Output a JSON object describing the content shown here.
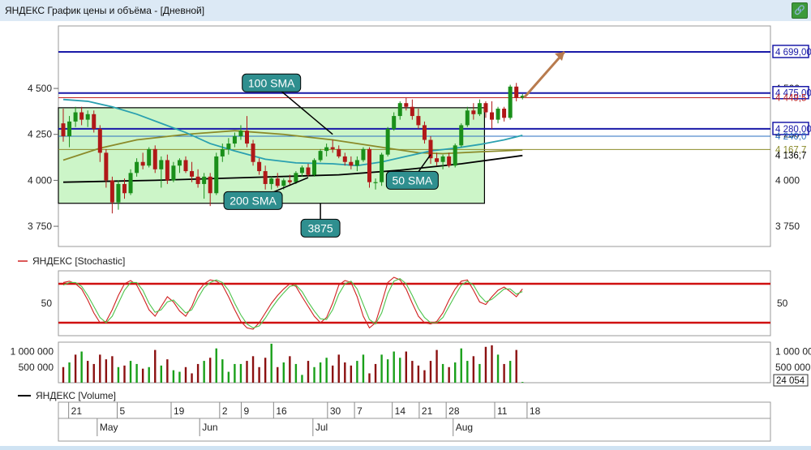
{
  "window": {
    "title": "ЯНДЕКС График цены и объёма - [Дневной]",
    "button_icon": "link-icon"
  },
  "chart_data": [
    {
      "type": "candlestick",
      "title": "ЯНДЕКС",
      "y_ticks": [
        "4 500",
        "4 250",
        "4 000",
        "3 750"
      ],
      "y_tick_values": [
        4500,
        4250,
        4000,
        3750
      ],
      "ylim": [
        3640,
        4840
      ],
      "n_bars": 76,
      "candles": [
        {
          "o": 4310,
          "h": 4390,
          "l": 4210,
          "c": 4240
        },
        {
          "o": 4240,
          "h": 4350,
          "l": 4180,
          "c": 4320
        },
        {
          "o": 4320,
          "h": 4400,
          "l": 4290,
          "c": 4370
        },
        {
          "o": 4370,
          "h": 4400,
          "l": 4300,
          "c": 4330
        },
        {
          "o": 4330,
          "h": 4380,
          "l": 4290,
          "c": 4360
        },
        {
          "o": 4360,
          "h": 4380,
          "l": 4260,
          "c": 4280
        },
        {
          "o": 4280,
          "h": 4300,
          "l": 4100,
          "c": 4150
        },
        {
          "o": 4150,
          "h": 4170,
          "l": 3960,
          "c": 4000
        },
        {
          "o": 4000,
          "h": 4020,
          "l": 3820,
          "c": 3880
        },
        {
          "o": 3880,
          "h": 4000,
          "l": 3840,
          "c": 3980
        },
        {
          "o": 3980,
          "h": 4010,
          "l": 3900,
          "c": 3930
        },
        {
          "o": 3930,
          "h": 4060,
          "l": 3920,
          "c": 4040
        },
        {
          "o": 4040,
          "h": 4120,
          "l": 4020,
          "c": 4100
        },
        {
          "o": 4100,
          "h": 4150,
          "l": 4060,
          "c": 4080
        },
        {
          "o": 4080,
          "h": 4180,
          "l": 4070,
          "c": 4170
        },
        {
          "o": 4170,
          "h": 4190,
          "l": 4040,
          "c": 4060
        },
        {
          "o": 4060,
          "h": 4130,
          "l": 3960,
          "c": 4110
        },
        {
          "o": 4110,
          "h": 4140,
          "l": 3980,
          "c": 4000
        },
        {
          "o": 4000,
          "h": 4100,
          "l": 3990,
          "c": 4080
        },
        {
          "o": 4080,
          "h": 4120,
          "l": 4040,
          "c": 4110
        },
        {
          "o": 4110,
          "h": 4130,
          "l": 4040,
          "c": 4050
        },
        {
          "o": 4050,
          "h": 4100,
          "l": 3990,
          "c": 4020
        },
        {
          "o": 4020,
          "h": 4060,
          "l": 3960,
          "c": 3980
        },
        {
          "o": 3980,
          "h": 4040,
          "l": 3900,
          "c": 4020
        },
        {
          "o": 4020,
          "h": 4040,
          "l": 3860,
          "c": 3930
        },
        {
          "o": 3930,
          "h": 4150,
          "l": 3920,
          "c": 4130
        },
        {
          "o": 4130,
          "h": 4200,
          "l": 4100,
          "c": 4170
        },
        {
          "o": 4170,
          "h": 4230,
          "l": 4140,
          "c": 4200
        },
        {
          "o": 4200,
          "h": 4260,
          "l": 4180,
          "c": 4240
        },
        {
          "o": 4240,
          "h": 4300,
          "l": 4220,
          "c": 4270
        },
        {
          "o": 4270,
          "h": 4350,
          "l": 4180,
          "c": 4200
        },
        {
          "o": 4200,
          "h": 4220,
          "l": 4080,
          "c": 4100
        },
        {
          "o": 4100,
          "h": 4120,
          "l": 4030,
          "c": 4050
        },
        {
          "o": 4050,
          "h": 4080,
          "l": 3950,
          "c": 3980
        },
        {
          "o": 3980,
          "h": 4020,
          "l": 3950,
          "c": 4010
        },
        {
          "o": 4010,
          "h": 4040,
          "l": 3960,
          "c": 3970
        },
        {
          "o": 3970,
          "h": 4010,
          "l": 3950,
          "c": 4000
        },
        {
          "o": 4000,
          "h": 4030,
          "l": 3970,
          "c": 3990
        },
        {
          "o": 3990,
          "h": 4050,
          "l": 3980,
          "c": 4040
        },
        {
          "o": 4040,
          "h": 4080,
          "l": 4020,
          "c": 4070
        },
        {
          "o": 4070,
          "h": 4090,
          "l": 4020,
          "c": 4030
        },
        {
          "o": 4030,
          "h": 4120,
          "l": 4020,
          "c": 4110
        },
        {
          "o": 4110,
          "h": 4170,
          "l": 4100,
          "c": 4160
        },
        {
          "o": 4160,
          "h": 4200,
          "l": 4130,
          "c": 4180
        },
        {
          "o": 4180,
          "h": 4220,
          "l": 4150,
          "c": 4170
        },
        {
          "o": 4170,
          "h": 4190,
          "l": 4120,
          "c": 4130
        },
        {
          "o": 4130,
          "h": 4150,
          "l": 4080,
          "c": 4100
        },
        {
          "o": 4100,
          "h": 4130,
          "l": 4060,
          "c": 4080
        },
        {
          "o": 4080,
          "h": 4130,
          "l": 4050,
          "c": 4110
        },
        {
          "o": 4110,
          "h": 4180,
          "l": 4100,
          "c": 4170
        },
        {
          "o": 4170,
          "h": 4180,
          "l": 3960,
          "c": 3990
        },
        {
          "o": 3990,
          "h": 4010,
          "l": 3950,
          "c": 3990
        },
        {
          "o": 3990,
          "h": 4150,
          "l": 3970,
          "c": 4140
        },
        {
          "o": 4140,
          "h": 4290,
          "l": 4130,
          "c": 4280
        },
        {
          "o": 4280,
          "h": 4370,
          "l": 4270,
          "c": 4350
        },
        {
          "o": 4350,
          "h": 4430,
          "l": 4330,
          "c": 4420
        },
        {
          "o": 4420,
          "h": 4450,
          "l": 4380,
          "c": 4400
        },
        {
          "o": 4400,
          "h": 4440,
          "l": 4330,
          "c": 4350
        },
        {
          "o": 4350,
          "h": 4390,
          "l": 4280,
          "c": 4300
        },
        {
          "o": 4300,
          "h": 4320,
          "l": 4200,
          "c": 4220
        },
        {
          "o": 4220,
          "h": 4240,
          "l": 4090,
          "c": 4120
        },
        {
          "o": 4120,
          "h": 4150,
          "l": 4080,
          "c": 4100
        },
        {
          "o": 4100,
          "h": 4140,
          "l": 4060,
          "c": 4130
        },
        {
          "o": 4130,
          "h": 4150,
          "l": 4070,
          "c": 4080
        },
        {
          "o": 4080,
          "h": 4200,
          "l": 4070,
          "c": 4190
        },
        {
          "o": 4190,
          "h": 4310,
          "l": 4180,
          "c": 4300
        },
        {
          "o": 4300,
          "h": 4400,
          "l": 4290,
          "c": 4380
        },
        {
          "o": 4380,
          "h": 4420,
          "l": 4330,
          "c": 4360
        },
        {
          "o": 4360,
          "h": 4440,
          "l": 4350,
          "c": 4420
        },
        {
          "o": 4420,
          "h": 4430,
          "l": 4340,
          "c": 4370
        },
        {
          "o": 4370,
          "h": 4430,
          "l": 4280,
          "c": 4330
        },
        {
          "o": 4330,
          "h": 4400,
          "l": 4310,
          "c": 4390
        },
        {
          "o": 4390,
          "h": 4400,
          "l": 4320,
          "c": 4340
        },
        {
          "o": 4340,
          "h": 4520,
          "l": 4330,
          "c": 4510
        },
        {
          "o": 4510,
          "h": 4530,
          "l": 4430,
          "c": 4450
        },
        {
          "o": 4450,
          "h": 4470,
          "l": 4440,
          "c": 4460
        }
      ],
      "sma": [
        {
          "name": "200 SMA",
          "color": "#000000",
          "points": [
            [
              0,
              3990
            ],
            [
              15,
              4000
            ],
            [
              30,
              4015
            ],
            [
              45,
              4030
            ],
            [
              55,
              4055
            ],
            [
              65,
              4090
            ],
            [
              75,
              4135
            ]
          ]
        },
        {
          "name": "100 SMA",
          "color": "#8b8b2a",
          "points": [
            [
              0,
              4110
            ],
            [
              6,
              4175
            ],
            [
              12,
              4220
            ],
            [
              20,
              4250
            ],
            [
              28,
              4270
            ],
            [
              36,
              4250
            ],
            [
              44,
              4220
            ],
            [
              52,
              4180
            ],
            [
              58,
              4150
            ],
            [
              62,
              4145
            ],
            [
              68,
              4155
            ],
            [
              75,
              4165
            ]
          ]
        },
        {
          "name": "50 SMA",
          "color": "#2aa0b0",
          "points": [
            [
              0,
              4440
            ],
            [
              4,
              4430
            ],
            [
              8,
              4400
            ],
            [
              12,
              4360
            ],
            [
              16,
              4310
            ],
            [
              20,
              4260
            ],
            [
              24,
              4200
            ],
            [
              28,
              4160
            ],
            [
              33,
              4115
            ],
            [
              38,
              4095
            ],
            [
              44,
              4090
            ],
            [
              48,
              4080
            ],
            [
              52,
              4100
            ],
            [
              56,
              4130
            ],
            [
              60,
              4160
            ],
            [
              64,
              4175
            ],
            [
              68,
              4195
            ],
            [
              72,
              4220
            ],
            [
              75,
              4245
            ]
          ]
        }
      ],
      "price_labels": [
        {
          "text": "4 699,00",
          "value": 4699,
          "color": "#1a1aa8"
        },
        {
          "text": "4 475,00",
          "value": 4475,
          "color": "#1a1aa8"
        },
        {
          "text": "4 449,5",
          "value": 4449.5,
          "color": "#c02020"
        },
        {
          "text": "4 280,00",
          "value": 4280,
          "color": "#1a1aa8"
        },
        {
          "text": "4 240,0",
          "value": 4240,
          "color": "#2a6fc0"
        },
        {
          "text": "4 167,7",
          "value": 4167.7,
          "color": "#8b8b2a"
        },
        {
          "text": "4 136,7",
          "value": 4136.7,
          "color": "#000000"
        }
      ],
      "box": {
        "top": 4395,
        "bottom": 3875,
        "start_bar": 0,
        "end_bar": 68
      },
      "callouts": [
        {
          "text": "100 SMA",
          "bar": 34,
          "value": 4530
        },
        {
          "text": "200 SMA",
          "bar": 31,
          "value": 3890
        },
        {
          "text": "3875",
          "bar": 42,
          "value": 3740
        },
        {
          "text": "50 SMA",
          "bar": 57,
          "value": 4000
        }
      ]
    },
    {
      "type": "line",
      "title": "ЯНДЕКС [Stochastic]",
      "y_ticks": [
        "50"
      ],
      "levels": [
        80,
        20
      ],
      "series": [
        {
          "color": "#d02020",
          "values": [
            82,
            84,
            80,
            72,
            55,
            35,
            20,
            22,
            40,
            62,
            80,
            85,
            78,
            60,
            40,
            30,
            45,
            60,
            52,
            38,
            30,
            45,
            68,
            80,
            86,
            84,
            78,
            60,
            40,
            22,
            12,
            10,
            20,
            35,
            50,
            62,
            72,
            80,
            76,
            60,
            45,
            30,
            20,
            28,
            50,
            78,
            85,
            82,
            60,
            30,
            12,
            20,
            50,
            82,
            90,
            86,
            72,
            50,
            30,
            20,
            18,
            22,
            35,
            55,
            72,
            84,
            86,
            70,
            52,
            48,
            60,
            70,
            75,
            68,
            60,
            72
          ]
        },
        {
          "color": "#4cc44c",
          "values": [
            78,
            82,
            82,
            76,
            62,
            45,
            28,
            20,
            30,
            50,
            70,
            82,
            82,
            70,
            50,
            36,
            40,
            52,
            55,
            45,
            35,
            40,
            58,
            74,
            82,
            86,
            82,
            70,
            50,
            32,
            18,
            12,
            15,
            27,
            42,
            55,
            66,
            76,
            78,
            68,
            52,
            38,
            26,
            25,
            40,
            64,
            80,
            84,
            72,
            48,
            25,
            18,
            35,
            65,
            84,
            88,
            80,
            62,
            42,
            28,
            20,
            20,
            28,
            45,
            62,
            78,
            84,
            78,
            62,
            52,
            56,
            64,
            72,
            72,
            64,
            68
          ]
        }
      ]
    },
    {
      "type": "bar",
      "title": "ЯНДЕКС [Volume]",
      "y_ticks": [
        "1 000 000",
        "500 000"
      ],
      "right_ticks": [
        "1 000 000",
        "500 000"
      ],
      "last_value_label": "24 054",
      "ymax": 1300000,
      "values": [
        500000,
        650000,
        900000,
        1000000,
        700000,
        600000,
        900000,
        750000,
        850000,
        500000,
        550000,
        700000,
        600000,
        450000,
        500000,
        1050000,
        550000,
        750000,
        400000,
        350000,
        500000,
        300000,
        600000,
        700000,
        800000,
        1100000,
        750000,
        350000,
        600000,
        600000,
        700000,
        850000,
        500000,
        800000,
        1250000,
        500000,
        650000,
        850000,
        600000,
        250000,
        700000,
        500000,
        650000,
        800000,
        550000,
        900000,
        650000,
        550000,
        700000,
        900000,
        300000,
        600000,
        900000,
        750000,
        1000000,
        800000,
        1000000,
        700000,
        550000,
        400000,
        700000,
        1050000,
        600000,
        500000,
        650000,
        1100000,
        700000,
        850000,
        600000,
        1150000,
        1200000,
        900000,
        600000,
        700000,
        1050000,
        24054
      ],
      "up_flags": [
        0,
        1,
        0,
        1,
        0,
        0,
        0,
        0,
        0,
        1,
        0,
        1,
        1,
        0,
        1,
        0,
        1,
        0,
        1,
        1,
        0,
        0,
        0,
        1,
        0,
        1,
        1,
        1,
        1,
        1,
        0,
        0,
        0,
        0,
        1,
        0,
        1,
        0,
        1,
        1,
        0,
        1,
        1,
        1,
        0,
        0,
        0,
        0,
        1,
        1,
        0,
        0,
        1,
        1,
        1,
        1,
        0,
        0,
        0,
        0,
        0,
        0,
        1,
        0,
        1,
        1,
        1,
        0,
        1,
        0,
        0,
        1,
        0,
        1,
        0,
        1
      ]
    }
  ],
  "x_axis": {
    "day_labels": [
      "21",
      "5",
      "19",
      "2",
      "9",
      "16",
      "30",
      "7",
      "14",
      "21",
      "28",
      "11",
      "18"
    ],
    "day_bars": [
      1,
      10,
      20,
      29,
      33,
      39,
      49,
      54,
      61,
      66,
      71,
      80,
      86
    ],
    "month_labels": [
      "May",
      "Jun",
      "Jul",
      "Aug"
    ],
    "month_bars": [
      9,
      28,
      49,
      75
    ]
  },
  "panel_titles": {
    "stochastic": "ЯНДЕКС [Stochastic]",
    "volume": "ЯНДЕКС [Volume]"
  }
}
